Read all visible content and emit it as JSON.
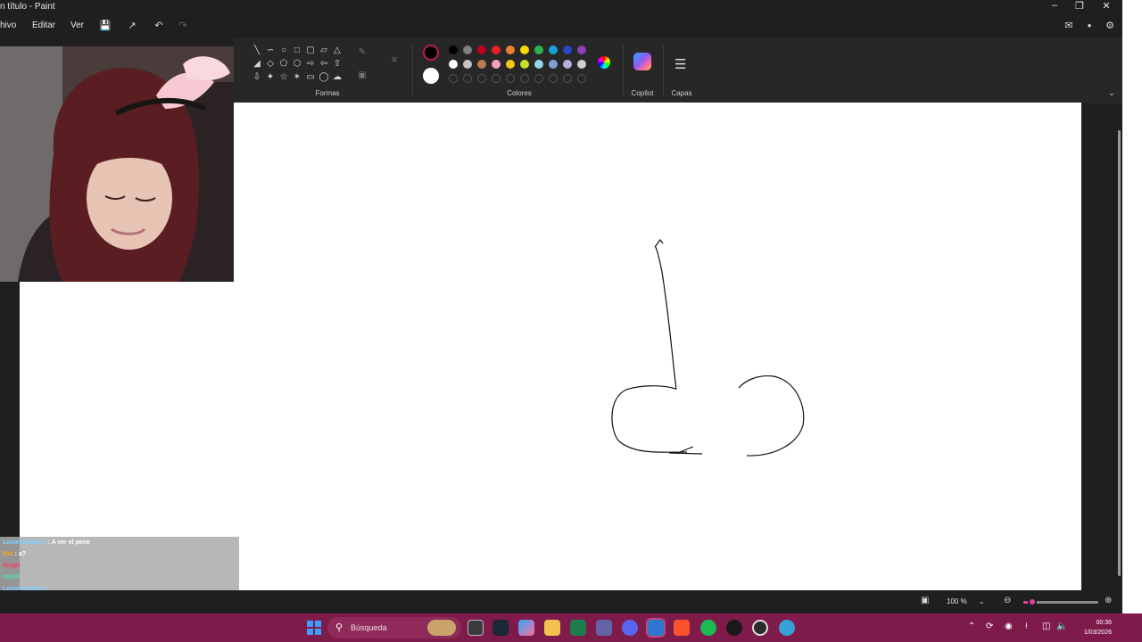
{
  "window": {
    "title": "n título - Paint",
    "minimize_icon": "minimize-icon",
    "maximize_icon": "restore-icon",
    "close_icon": "close-icon"
  },
  "menu": {
    "items": [
      "hivo",
      "Editar",
      "Ver"
    ],
    "quick_actions": [
      "save-icon",
      "share-icon",
      "undo-icon",
      "redo-icon"
    ],
    "right_actions": [
      "feedback-icon",
      "account-icon",
      "settings-icon"
    ]
  },
  "ribbon": {
    "shapes_label": "Formas",
    "colors_label": "Colores",
    "copilot_label": "Copilot",
    "layers_label": "Capas",
    "primary_color": "#000000",
    "secondary_color": "#ffffff",
    "palette_row1": [
      "#000000",
      "#7f7f7f",
      "#c00020",
      "#e8202a",
      "#f08030",
      "#f7d900",
      "#2bb24c",
      "#18a0d8",
      "#2b47c6",
      "#8e3fb6"
    ],
    "palette_row2": [
      "#ffffff",
      "#c3c3c3",
      "#b97a57",
      "#f79fc0",
      "#f5c518",
      "#c3e02a",
      "#90d8e8",
      "#7e9ed6",
      "#b5b0e0",
      "#cfcfcf"
    ]
  },
  "chat": {
    "messages": [
      {
        "user": "LouieCampers",
        "text": ": A ver el pene",
        "color": "#7ad0ff",
        "boxed": true
      },
      {
        "user": "Mal",
        "text": ": a?",
        "color": "#f5a623",
        "boxed": true
      },
      {
        "user": "Angel",
        "text": "",
        "color": "#ff3b5c",
        "boxed": true
      },
      {
        "user": "tobilli",
        "text": "",
        "color": "#4fe3a8",
        "boxed": true
      },
      {
        "user": "LouieCampers",
        "text": "",
        "color": "#7ad0ff",
        "boxed": true
      },
      {
        "user": "",
        "text": ": !mura Pausita le puedes decir una pregunta para Aldhaircito",
        "color": "#9b7bff",
        "boxed": false
      },
      {
        "user": "kncer69k",
        "text": ": !mura dibuja el pene que mas te haya gustado",
        "color": "#ffffff",
        "boxed": false
      },
      {
        "user": "",
        "text": ": !mura tan templada estas de hisoka ke te vas a copiar su look",
        "color": "#9b7bff",
        "boxed": false
      },
      {
        "user": "LouieCampers",
        "text": ": perfecto pene",
        "color": "#7ad0ff",
        "boxed": false
      }
    ]
  },
  "status": {
    "zoom": "100 %",
    "zoom_level": 0.12
  },
  "taskbar": {
    "search_placeholder": "Búsqueda",
    "time": "00:36",
    "date": "1/03/2026"
  }
}
